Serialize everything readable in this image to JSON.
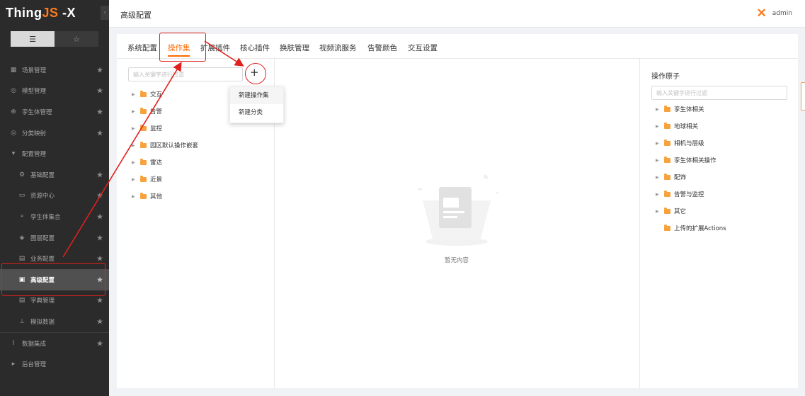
{
  "app": {
    "logo_main": "Thing",
    "logo_accent": "JS",
    "logo_suffix": " -X"
  },
  "header": {
    "title": "高级配置",
    "username": "admin"
  },
  "sidebar": {
    "tab_list_icon": "☰",
    "tab_star_icon": "☆",
    "items": [
      {
        "label": "场景管理",
        "icon": "▦",
        "level": 0,
        "star": true
      },
      {
        "label": "模型管理",
        "icon": "◎",
        "level": 0,
        "star": true
      },
      {
        "label": "孪生体管理",
        "icon": "⊕",
        "level": 0,
        "star": true
      },
      {
        "label": "分类映射",
        "icon": "◎",
        "level": 0,
        "star": true
      },
      {
        "label": "配置管理",
        "icon": "▾",
        "level": 0,
        "star": false
      },
      {
        "label": "基础配置",
        "icon": "⚙",
        "level": 1,
        "star": true
      },
      {
        "label": "资源中心",
        "icon": "▭",
        "level": 1,
        "star": true
      },
      {
        "label": "孪生体集合",
        "icon": "⚬",
        "level": 1,
        "star": true
      },
      {
        "label": "图层配置",
        "icon": "◈",
        "level": 1,
        "star": true
      },
      {
        "label": "业务配置",
        "icon": "▤",
        "level": 1,
        "star": true
      },
      {
        "label": "高级配置",
        "icon": "▣",
        "level": 1,
        "star": true,
        "active": true
      },
      {
        "label": "字典管理",
        "icon": "▤",
        "level": 1,
        "star": true
      },
      {
        "label": "模拟数据",
        "icon": "⊥",
        "level": 1,
        "star": true
      },
      {
        "label": "数据集成",
        "icon": "⌇",
        "level": 0,
        "star": true
      },
      {
        "label": "后台管理",
        "icon": "▸",
        "level": 0,
        "star": false
      }
    ]
  },
  "tabs": [
    "系统配置",
    "操作集",
    "扩展插件",
    "核心插件",
    "换肤管理",
    "视频流服务",
    "告警颜色",
    "交互设置"
  ],
  "active_tab": "操作集",
  "left_panel": {
    "search_placeholder": "输入关键字进行过滤",
    "plus_label": "+",
    "tree": [
      "交互",
      "告警",
      "监控",
      "园区默认操作嵌套",
      "雷达",
      "近景",
      "其他"
    ]
  },
  "dropdown": {
    "items": [
      "新建操作集",
      "新建分类"
    ]
  },
  "middle_panel": {
    "empty_text": "暂无内容"
  },
  "right_panel": {
    "title": "操作原子",
    "search_placeholder": "输入关键字进行过滤",
    "tree": [
      {
        "label": "孪生体相关",
        "expandable": true
      },
      {
        "label": "地球相关",
        "expandable": true
      },
      {
        "label": "相机与层级",
        "expandable": true
      },
      {
        "label": "孪生体相关操作",
        "expandable": true
      },
      {
        "label": "配饰",
        "expandable": true
      },
      {
        "label": "告警与监控",
        "expandable": true
      },
      {
        "label": "其它",
        "expandable": true
      },
      {
        "label": "上传的扩展Actions",
        "expandable": false
      }
    ]
  },
  "colors": {
    "accent": "#ff6a00",
    "folder": "#f7a23c",
    "annotation": "#e0201d",
    "sidebar_bg": "#2b2b2b"
  }
}
